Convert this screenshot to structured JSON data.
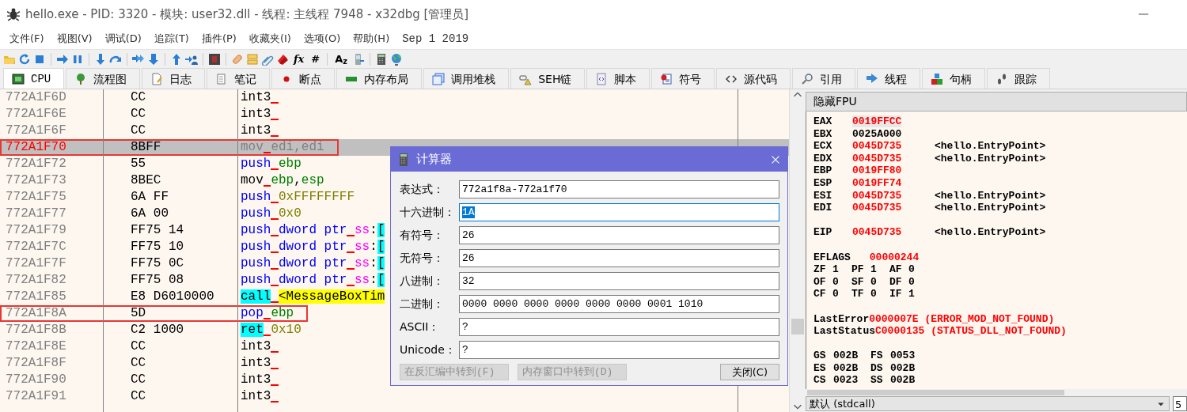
{
  "window": {
    "title": "hello.exe - PID: 3320 - 模块: user32.dll - 线程: 主线程 7948 - x32dbg [管理员]"
  },
  "menu": [
    "文件(F)",
    "视图(V)",
    "调试(D)",
    "追踪(T)",
    "插件(P)",
    "收藏夹(I)",
    "选项(O)",
    "帮助(H)"
  ],
  "build_date": "Sep 1 2019",
  "toolbar_glyphs": [
    "fx",
    "#",
    "A$_{z}$"
  ],
  "tabs": [
    {
      "label": "CPU",
      "selected": true
    },
    {
      "label": "流程图",
      "selected": false
    },
    {
      "label": "日志",
      "selected": false
    },
    {
      "label": "笔记",
      "selected": false
    },
    {
      "label": "断点",
      "selected": false
    },
    {
      "label": "内存布局",
      "selected": false
    },
    {
      "label": "调用堆栈",
      "selected": false
    },
    {
      "label": "SEH链",
      "selected": false
    },
    {
      "label": "脚本",
      "selected": false
    },
    {
      "label": "符号",
      "selected": false
    },
    {
      "label": "源代码",
      "selected": false
    },
    {
      "label": "引用",
      "selected": false
    },
    {
      "label": "线程",
      "selected": false
    },
    {
      "label": "句柄",
      "selected": false
    },
    {
      "label": "跟踪",
      "selected": false
    }
  ],
  "disassembly": {
    "rows": [
      {
        "address": "772A1F6D",
        "bytes": "CC",
        "instruction": [
          {
            "kind": "plain",
            "text": "int3"
          },
          {
            "kind": "gap"
          }
        ],
        "selected": false,
        "boxed": false
      },
      {
        "address": "772A1F6E",
        "bytes": "CC",
        "instruction": [
          {
            "kind": "plain",
            "text": "int3"
          },
          {
            "kind": "gap"
          }
        ],
        "selected": false,
        "boxed": false
      },
      {
        "address": "772A1F6F",
        "bytes": "CC",
        "instruction": [
          {
            "kind": "plain",
            "text": "int3"
          },
          {
            "kind": "gap"
          }
        ],
        "selected": false,
        "boxed": false
      },
      {
        "address": "772A1F70",
        "bytes": "8BFF",
        "instruction": [
          {
            "kind": "plain",
            "text": "mov"
          },
          {
            "kind": "gap"
          },
          {
            "kind": "reg",
            "text": "edi"
          },
          {
            "kind": "plain",
            "text": ","
          },
          {
            "kind": "reg",
            "text": "edi"
          }
        ],
        "selected": true,
        "boxed": true
      },
      {
        "address": "772A1F72",
        "bytes": "55",
        "instruction": [
          {
            "kind": "stack",
            "text": "push"
          },
          {
            "kind": "gap"
          },
          {
            "kind": "reg",
            "text": "ebp"
          }
        ],
        "selected": false,
        "boxed": false
      },
      {
        "address": "772A1F73",
        "bytes": "8BEC",
        "instruction": [
          {
            "kind": "plain",
            "text": "mov"
          },
          {
            "kind": "gap"
          },
          {
            "kind": "reg",
            "text": "ebp"
          },
          {
            "kind": "plain",
            "text": ","
          },
          {
            "kind": "reg",
            "text": "esp"
          }
        ],
        "selected": false,
        "boxed": false
      },
      {
        "address": "772A1F75",
        "bytes": "6A FF",
        "instruction": [
          {
            "kind": "stack",
            "text": "push"
          },
          {
            "kind": "gap"
          },
          {
            "kind": "num",
            "text": "0xFFFFFFFF"
          }
        ],
        "selected": false,
        "boxed": false
      },
      {
        "address": "772A1F77",
        "bytes": "6A 00",
        "instruction": [
          {
            "kind": "stack",
            "text": "push"
          },
          {
            "kind": "gap"
          },
          {
            "kind": "num",
            "text": "0x0"
          }
        ],
        "selected": false,
        "boxed": false
      },
      {
        "address": "772A1F79",
        "bytes": "FF75 14",
        "instruction": [
          {
            "kind": "stack",
            "text": "push"
          },
          {
            "kind": "gap"
          },
          {
            "kind": "stack",
            "text": "dword ptr"
          },
          {
            "kind": "gap"
          },
          {
            "kind": "seg",
            "text": "ss"
          },
          {
            "kind": "plain",
            "text": ":"
          },
          {
            "kind": "bracket",
            "text": "["
          }
        ],
        "selected": false,
        "boxed": false
      },
      {
        "address": "772A1F7C",
        "bytes": "FF75 10",
        "instruction": [
          {
            "kind": "stack",
            "text": "push"
          },
          {
            "kind": "gap"
          },
          {
            "kind": "stack",
            "text": "dword ptr"
          },
          {
            "kind": "gap"
          },
          {
            "kind": "seg",
            "text": "ss"
          },
          {
            "kind": "plain",
            "text": ":"
          },
          {
            "kind": "bracket",
            "text": "["
          }
        ],
        "selected": false,
        "boxed": false
      },
      {
        "address": "772A1F7F",
        "bytes": "FF75 0C",
        "instruction": [
          {
            "kind": "stack",
            "text": "push"
          },
          {
            "kind": "gap"
          },
          {
            "kind": "stack",
            "text": "dword ptr"
          },
          {
            "kind": "gap"
          },
          {
            "kind": "seg",
            "text": "ss"
          },
          {
            "kind": "plain",
            "text": ":"
          },
          {
            "kind": "bracket",
            "text": "["
          }
        ],
        "selected": false,
        "boxed": false
      },
      {
        "address": "772A1F82",
        "bytes": "FF75 08",
        "instruction": [
          {
            "kind": "stack",
            "text": "push"
          },
          {
            "kind": "gap"
          },
          {
            "kind": "stack",
            "text": "dword ptr"
          },
          {
            "kind": "gap"
          },
          {
            "kind": "seg",
            "text": "ss"
          },
          {
            "kind": "plain",
            "text": ":"
          },
          {
            "kind": "bracket",
            "text": "["
          }
        ],
        "selected": false,
        "boxed": false
      },
      {
        "address": "772A1F85",
        "bytes": "E8 D6010000",
        "instruction": [
          {
            "kind": "branch",
            "text": "call"
          },
          {
            "kind": "gap"
          },
          {
            "kind": "label",
            "text": "<MessageBoxTim"
          }
        ],
        "selected": false,
        "boxed": false
      },
      {
        "address": "772A1F8A",
        "bytes": "5D",
        "instruction": [
          {
            "kind": "stack",
            "text": "pop"
          },
          {
            "kind": "gap"
          },
          {
            "kind": "reg",
            "text": "ebp"
          }
        ],
        "selected": false,
        "boxed": true
      },
      {
        "address": "772A1F8B",
        "bytes": "C2 1000",
        "instruction": [
          {
            "kind": "branch",
            "text": "ret"
          },
          {
            "kind": "gap"
          },
          {
            "kind": "num",
            "text": "0x10"
          }
        ],
        "selected": false,
        "boxed": false
      },
      {
        "address": "772A1F8E",
        "bytes": "CC",
        "instruction": [
          {
            "kind": "plain",
            "text": "int3"
          },
          {
            "kind": "gap"
          }
        ],
        "selected": false,
        "boxed": false
      },
      {
        "address": "772A1F8F",
        "bytes": "CC",
        "instruction": [
          {
            "kind": "plain",
            "text": "int3"
          },
          {
            "kind": "gap"
          }
        ],
        "selected": false,
        "boxed": false
      },
      {
        "address": "772A1F90",
        "bytes": "CC",
        "instruction": [
          {
            "kind": "plain",
            "text": "int3"
          },
          {
            "kind": "gap"
          }
        ],
        "selected": false,
        "boxed": false
      },
      {
        "address": "772A1F91",
        "bytes": "CC",
        "instruction": [
          {
            "kind": "plain",
            "text": "int3"
          },
          {
            "kind": "gap"
          }
        ],
        "selected": false,
        "boxed": false
      }
    ]
  },
  "calculator": {
    "title": "计算器",
    "fields": [
      {
        "label": "表达式：",
        "value": "772a1f8a-772a1f70",
        "selected": false
      },
      {
        "label": "十六进制：",
        "value": "1A",
        "selected": true
      },
      {
        "label": "有符号：",
        "value": "26",
        "selected": false
      },
      {
        "label": "无符号：",
        "value": "26",
        "selected": false
      },
      {
        "label": "八进制：",
        "value": "32",
        "selected": false
      },
      {
        "label": "二进制：",
        "value": "0000 0000 0000 0000 0000 0000 0001 1010",
        "selected": false
      },
      {
        "label": "ASCII：",
        "value": "?",
        "selected": false
      },
      {
        "label": "Unicode：",
        "value": "?",
        "selected": false
      }
    ],
    "buttons": [
      {
        "label": "在反汇编中转到(F)",
        "disabled": true
      },
      {
        "label": "内存窗口中转到(D)",
        "disabled": true
      },
      {
        "label": "关闭(C)",
        "disabled": false
      }
    ]
  },
  "registers": {
    "header": "隐藏FPU",
    "lines": [
      {
        "kind": "reg",
        "name": "EAX",
        "value": "0019FFCC",
        "changed": true,
        "selected": true
      },
      {
        "kind": "reg",
        "name": "EBX",
        "value": "0025A000",
        "changed": false,
        "selected": false
      },
      {
        "kind": "reg",
        "name": "ECX",
        "value": "0045D735",
        "changed": true,
        "selected": false,
        "comment": "<hello.EntryPoint>"
      },
      {
        "kind": "reg",
        "name": "EDX",
        "value": "0045D735",
        "changed": true,
        "selected": false,
        "comment": "<hello.EntryPoint>"
      },
      {
        "kind": "reg",
        "name": "EBP",
        "value": "0019FF80",
        "changed": true,
        "selected": false
      },
      {
        "kind": "reg",
        "name": "ESP",
        "value": "0019FF74",
        "changed": true,
        "selected": false
      },
      {
        "kind": "reg",
        "name": "ESI",
        "value": "0045D735",
        "changed": true,
        "selected": false,
        "comment": "<hello.EntryPoint>"
      },
      {
        "kind": "reg",
        "name": "EDI",
        "value": "0045D735",
        "changed": true,
        "selected": false,
        "comment": "<hello.EntryPoint>"
      },
      {
        "kind": "blank"
      },
      {
        "kind": "reg",
        "name": "EIP",
        "value": "0045D735",
        "changed": true,
        "selected": false,
        "comment": "<hello.EntryPoint>"
      },
      {
        "kind": "blank"
      },
      {
        "kind": "wide",
        "name": "EFLAGS",
        "value": "00000244",
        "changed": true
      },
      {
        "kind": "pairs",
        "items": [
          {
            "name": "ZF",
            "value": "1"
          },
          {
            "name": "PF",
            "value": "1"
          },
          {
            "name": "AF",
            "value": "0"
          }
        ]
      },
      {
        "kind": "pairs",
        "items": [
          {
            "name": "OF",
            "value": "0"
          },
          {
            "name": "SF",
            "value": "0"
          },
          {
            "name": "DF",
            "value": "0"
          }
        ]
      },
      {
        "kind": "pairs",
        "items": [
          {
            "name": "CF",
            "value": "0"
          },
          {
            "name": "TF",
            "value": "0"
          },
          {
            "name": "IF",
            "value": "1"
          }
        ]
      },
      {
        "kind": "blank"
      },
      {
        "kind": "wide",
        "name": "LastError",
        "value": "0000007E (ERROR_MOD_NOT_FOUND)",
        "changed": true
      },
      {
        "kind": "wide",
        "name": "LastStatus",
        "value": "C0000135 (STATUS_DLL_NOT_FOUND)",
        "changed": true
      },
      {
        "kind": "blank"
      },
      {
        "kind": "seg",
        "items": [
          {
            "name": "GS",
            "value": "002B"
          },
          {
            "name": "FS",
            "value": "0053"
          }
        ]
      },
      {
        "kind": "seg",
        "items": [
          {
            "name": "ES",
            "value": "002B"
          },
          {
            "name": "DS",
            "value": "002B"
          }
        ]
      },
      {
        "kind": "seg",
        "items": [
          {
            "name": "CS",
            "value": "0023"
          },
          {
            "name": "SS",
            "value": "002B"
          }
        ]
      }
    ],
    "calling_convention": "默认 (stdcall)",
    "argument_count": "5"
  }
}
